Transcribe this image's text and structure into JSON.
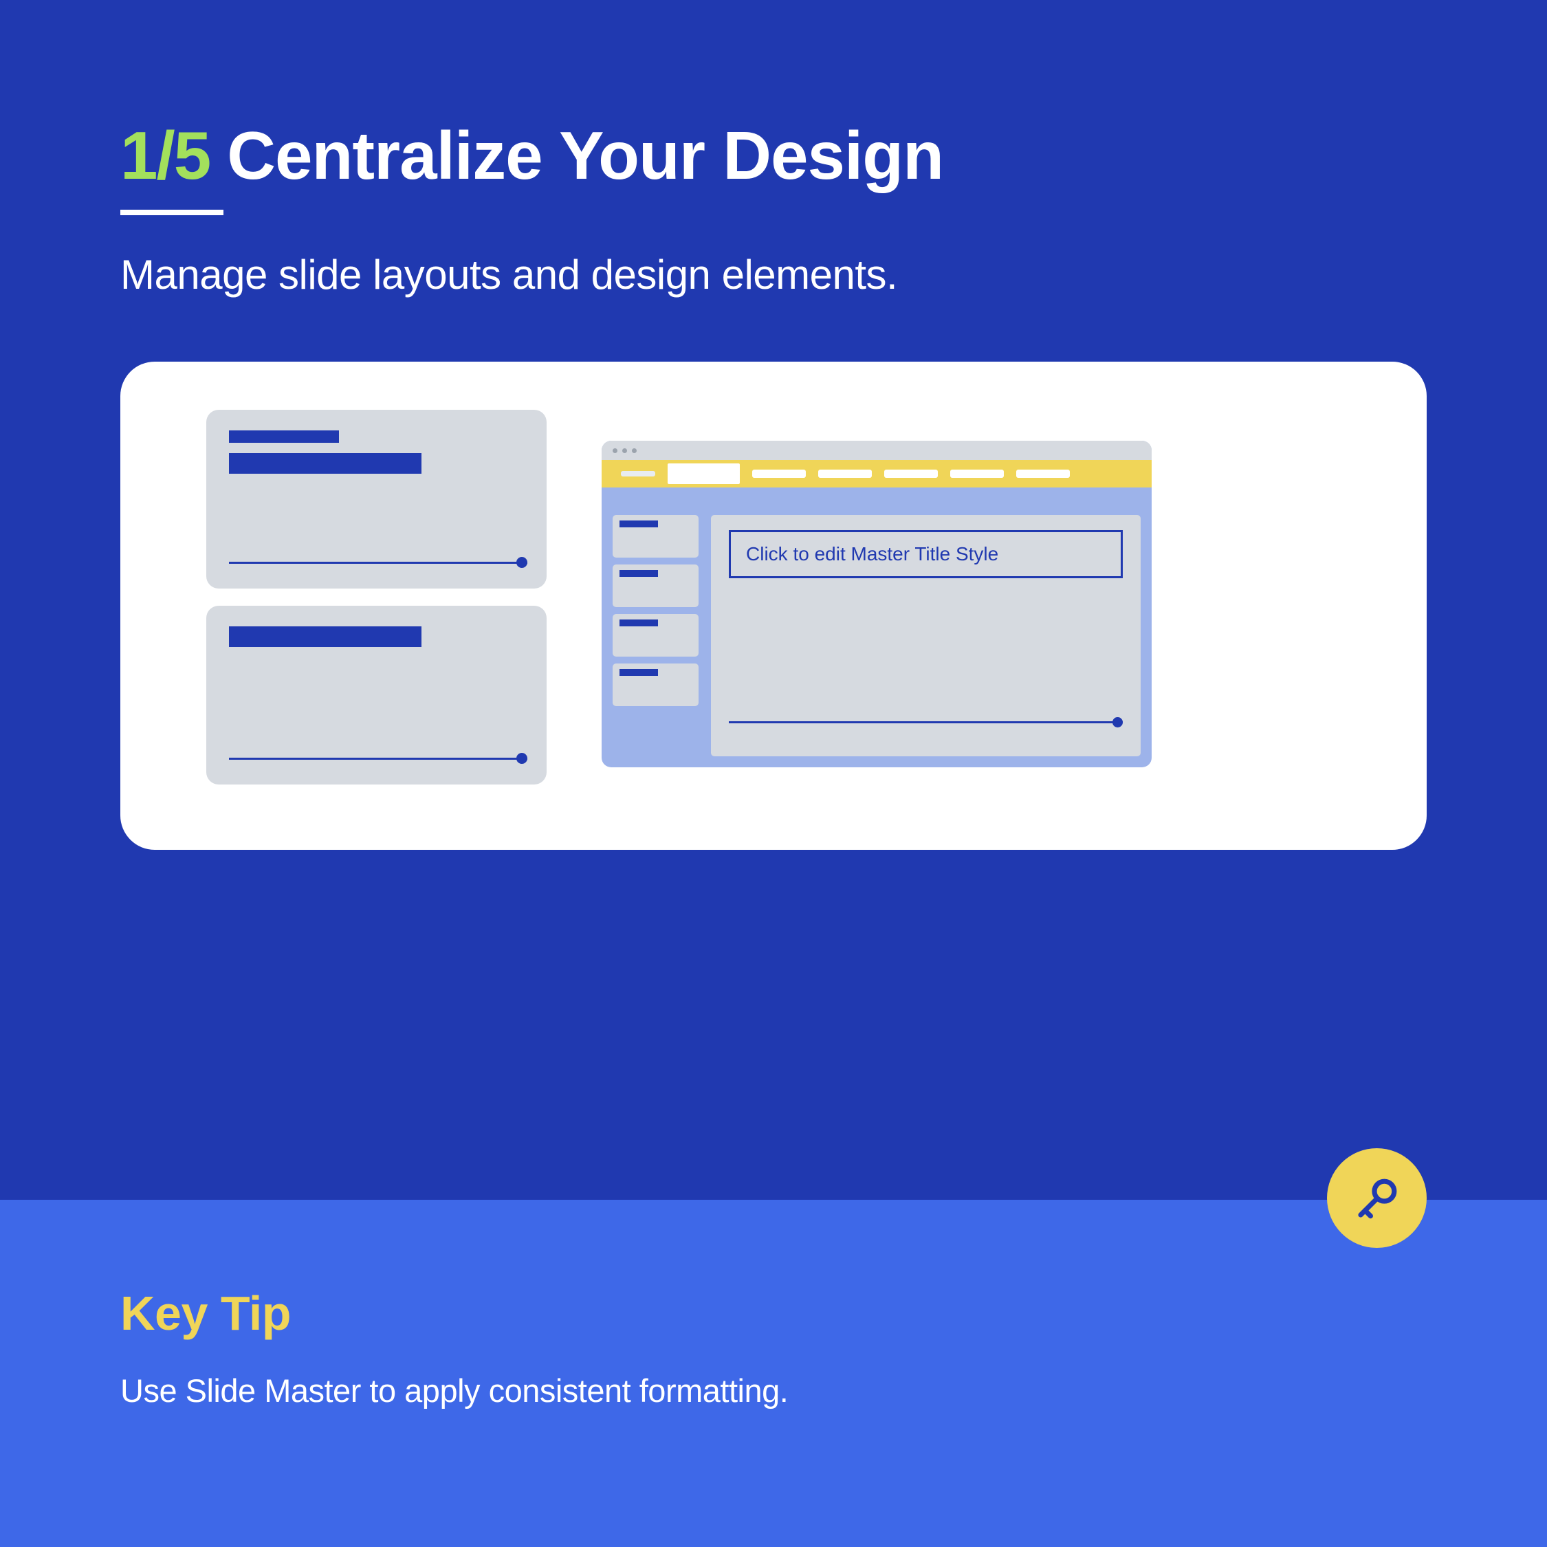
{
  "header": {
    "step_number": "1/5",
    "title": "Centralize Your Design",
    "subtitle": "Manage slide layouts and design elements."
  },
  "illustration": {
    "master_title_placeholder": "Click to edit Master Title Style"
  },
  "tip": {
    "label": "Key Tip",
    "text": "Use Slide Master to apply consistent formatting."
  },
  "colors": {
    "primary_blue": "#2039b0",
    "accent_green": "#a3e05c",
    "light_blue": "#3e68e8",
    "yellow": "#f0d558",
    "slide_gray": "#d6dae0",
    "window_blue": "#9db3ea"
  }
}
